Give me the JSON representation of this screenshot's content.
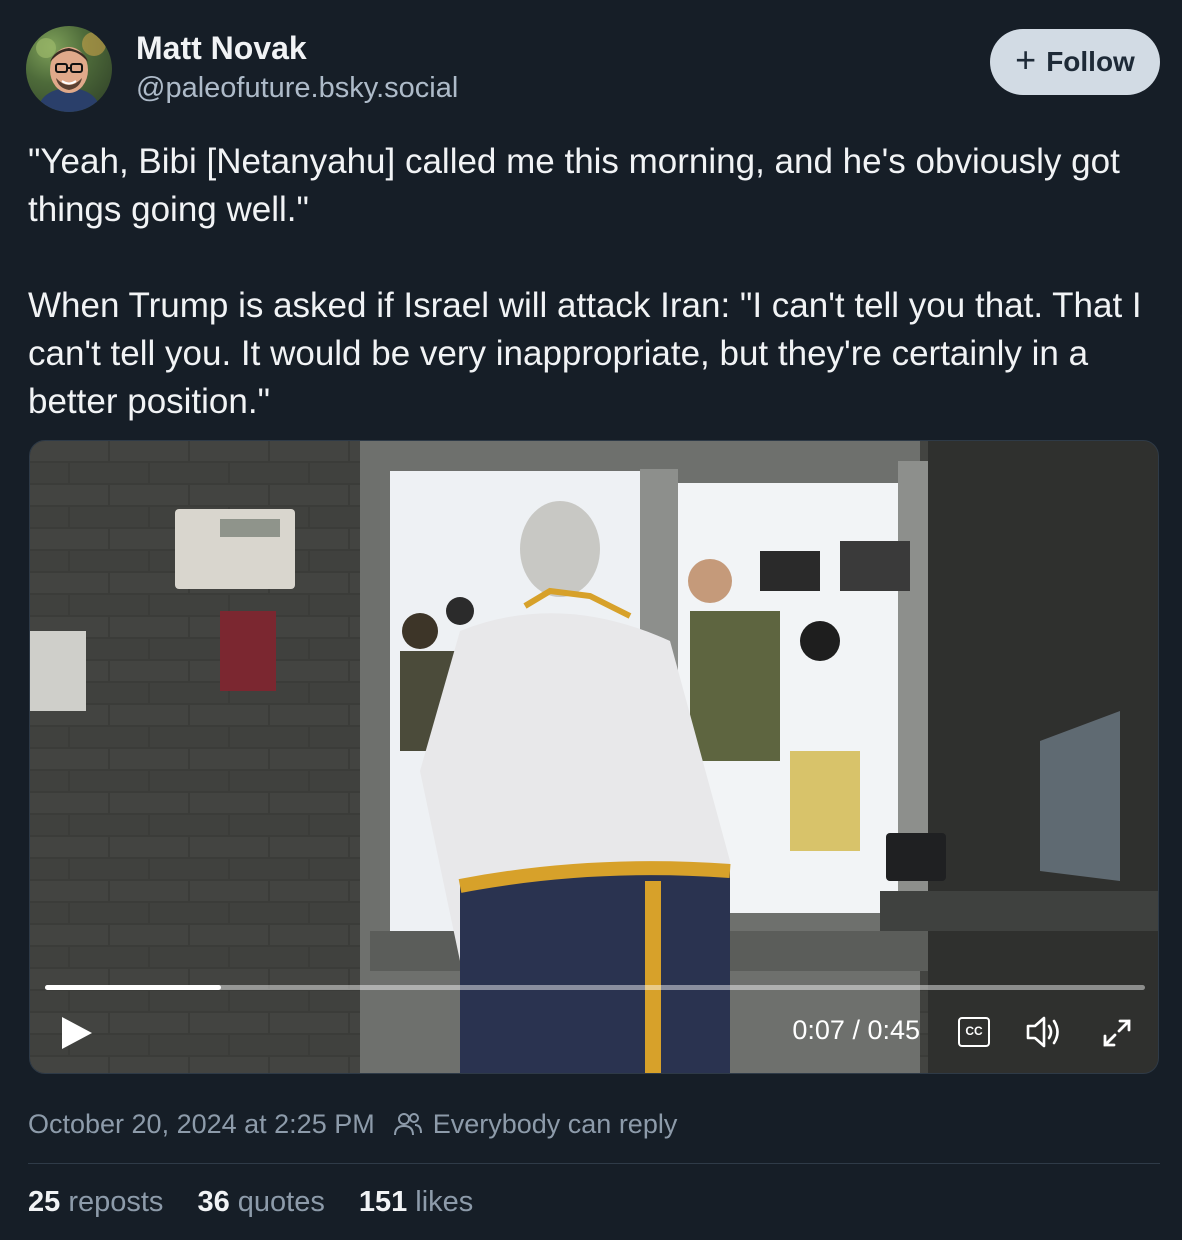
{
  "author": {
    "name": "Matt Novak",
    "handle": "@paleofuture.bsky.social"
  },
  "follow": {
    "label": "Follow",
    "icon": "plus-icon"
  },
  "post": {
    "paragraphs": [
      "\"Yeah, Bibi [Netanyahu] called me this morning, and he's obviously got things going well.\"",
      "When Trump is asked if Israel will attack Iran: \"I can't tell you that. That I can't tell you. It would be very inappropriate, but they're certainly in a better position.\""
    ]
  },
  "video": {
    "progress": 0.16,
    "current_time": "0:07",
    "duration": "0:45",
    "time_display": "0:07 / 0:45",
    "captions_label": "CC",
    "icons": [
      "play-icon",
      "captions-icon",
      "volume-icon",
      "fullscreen-icon"
    ]
  },
  "meta": {
    "timestamp": "October 20, 2024 at 2:25 PM",
    "reply_setting": "Everybody can reply",
    "reply_icon": "people-icon"
  },
  "stats": {
    "reposts_count": "25",
    "reposts_label": "reposts",
    "quotes_count": "36",
    "quotes_label": "quotes",
    "likes_count": "151",
    "likes_label": "likes"
  },
  "colors": {
    "background": "#161e27",
    "text": "#f1f3f5",
    "muted": "#8d9baa",
    "follow_bg": "#d2dbe4"
  }
}
